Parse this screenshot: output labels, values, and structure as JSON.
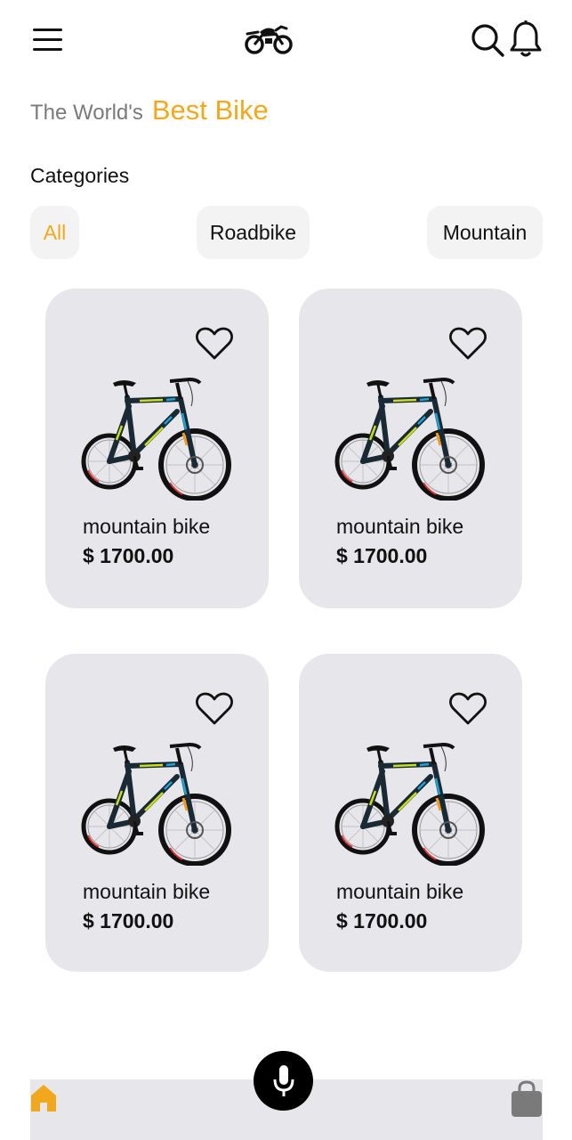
{
  "header": {
    "menu_icon": "hamburger-menu-icon",
    "logo_icon": "motorbike-logo-icon",
    "search_icon": "search-icon",
    "notification_icon": "bell-icon"
  },
  "headline": {
    "prefix": "The World's",
    "highlight": "Best Bike"
  },
  "categories": {
    "title": "Categories",
    "items": [
      {
        "label": "All",
        "active": true
      },
      {
        "label": "Roadbike",
        "active": false
      },
      {
        "label": "Mountain",
        "active": false
      }
    ]
  },
  "products": [
    {
      "name": "mountain bike",
      "price": "$ 1700.00",
      "favorite_icon": "heart-icon"
    },
    {
      "name": "mountain bike",
      "price": "$ 1700.00",
      "favorite_icon": "heart-icon"
    },
    {
      "name": "mountain bike",
      "price": "$ 1700.00",
      "favorite_icon": "heart-icon"
    },
    {
      "name": "mountain bike",
      "price": "$ 1700.00",
      "favorite_icon": "heart-icon"
    }
  ],
  "bottom_nav": {
    "home_icon": "home-icon",
    "mic_icon": "microphone-icon",
    "bag_icon": "shopping-bag-icon"
  },
  "colors": {
    "accent": "#f2a81d",
    "card_bg": "#e7e6eb",
    "chip_bg": "#f3f3f3",
    "text": "#111111",
    "muted_text": "#7a7a7a"
  }
}
